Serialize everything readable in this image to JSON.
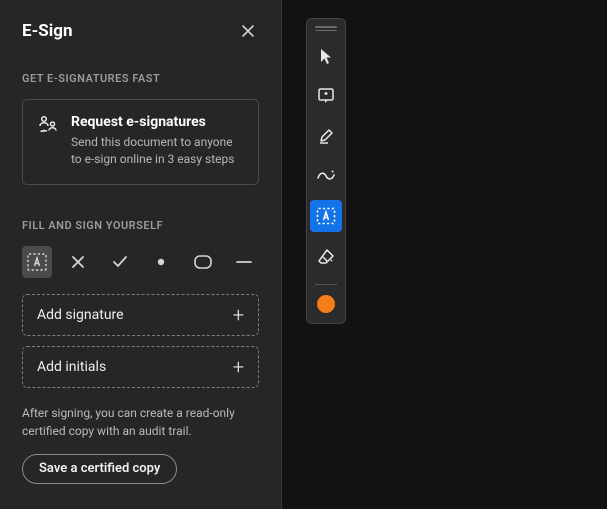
{
  "panel": {
    "title": "E-Sign",
    "section1_label": "GET E-SIGNATURES FAST",
    "request": {
      "title": "Request e-signatures",
      "desc": "Send this document to anyone to e-sign online in 3 easy steps"
    },
    "section2_label": "FILL AND SIGN YOURSELF",
    "add_signature": "Add signature",
    "add_initials": "Add initials",
    "after_text": "After signing, you can create a read-only certified copy with an audit trail.",
    "save_copy": "Save a certified copy"
  },
  "toolbar": {
    "color": "#f57c17"
  }
}
